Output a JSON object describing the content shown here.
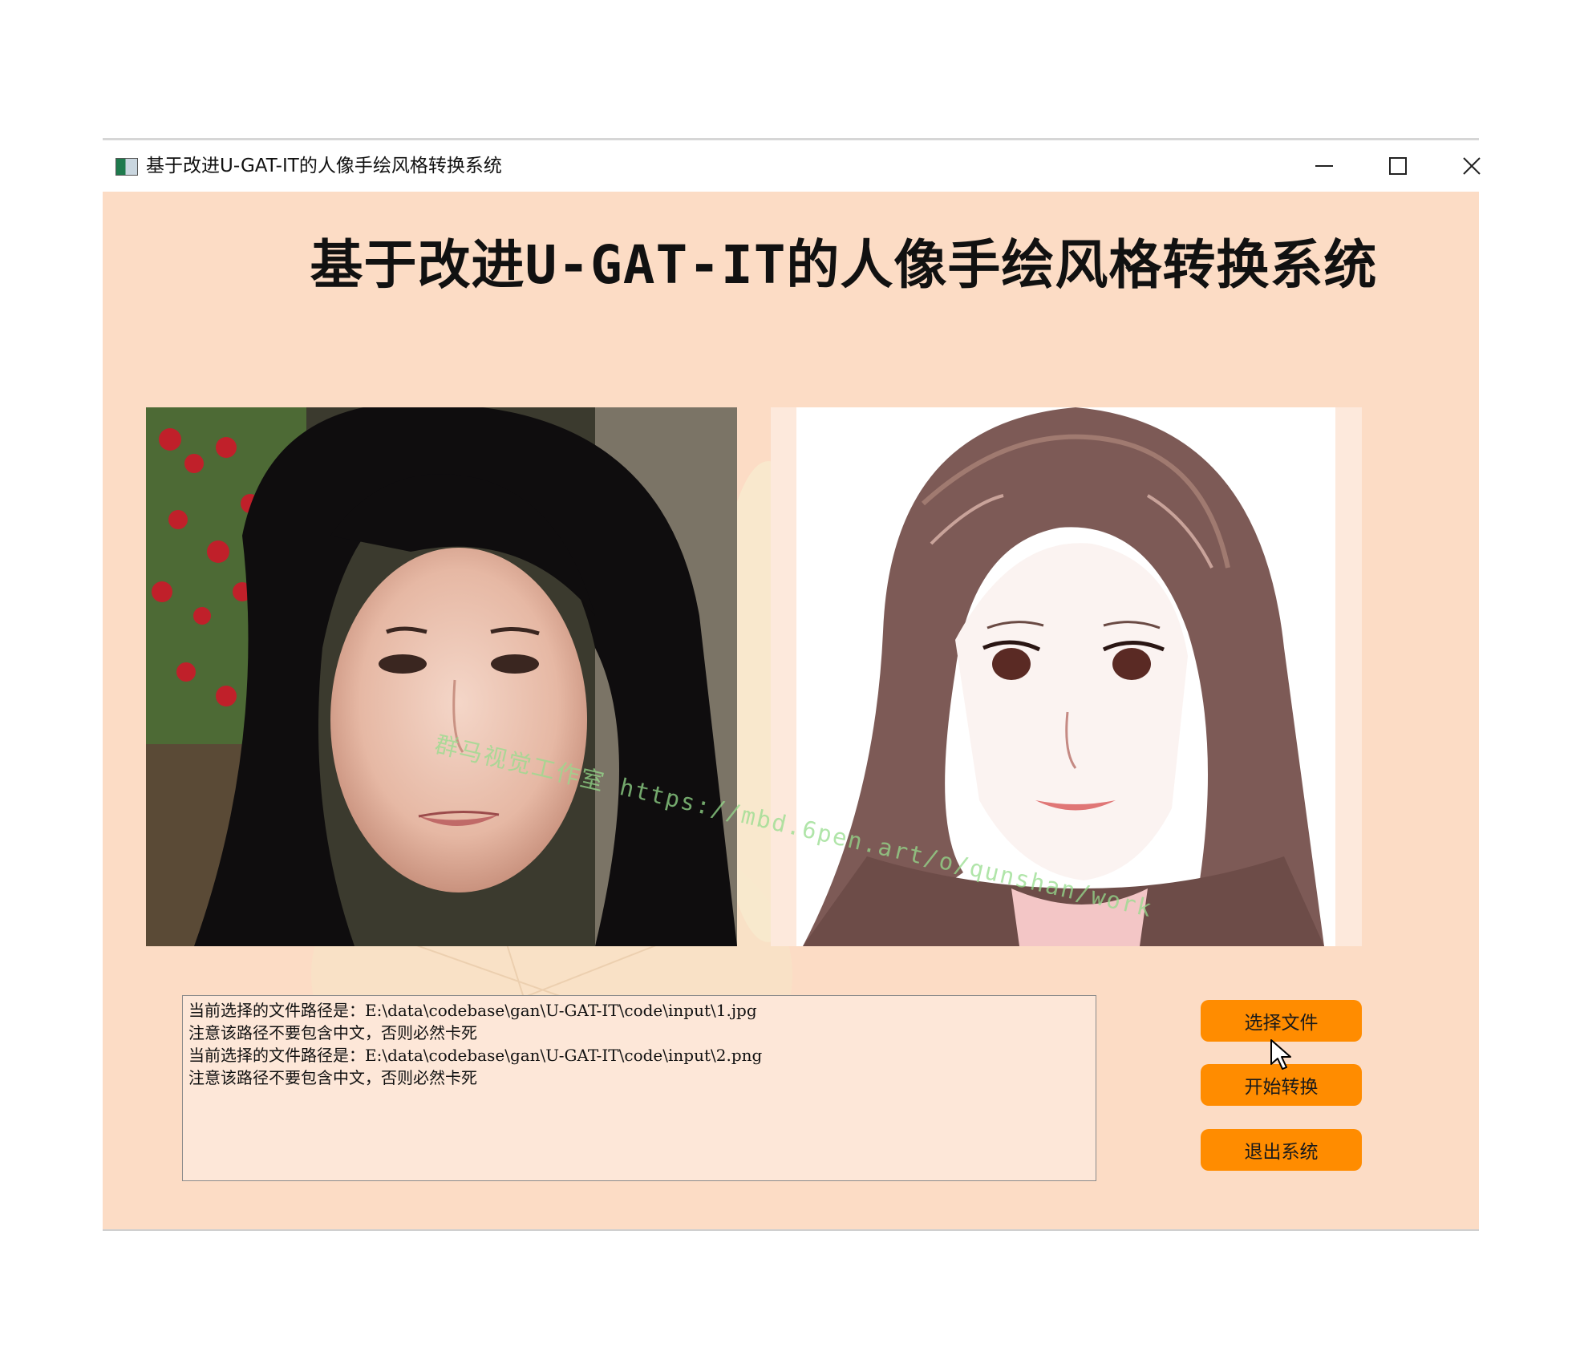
{
  "window": {
    "title": "基于改进U-GAT-IT的人像手绘风格转换系统"
  },
  "header": {
    "title": "基于改进U-GAT-IT的人像手绘风格转换系统"
  },
  "images": {
    "original": "portrait-photo",
    "converted": "hand-drawn-portrait"
  },
  "log": {
    "lines": [
      "当前选择的文件路径是：E:\\data\\codebase\\gan\\U-GAT-IT\\code\\input\\1.jpg",
      "注意该路径不要包含中文，否则必然卡死",
      "当前选择的文件路径是：E:\\data\\codebase\\gan\\U-GAT-IT\\code\\input\\2.png",
      "注意该路径不要包含中文，否则必然卡死"
    ]
  },
  "buttons": {
    "select_file": "选择文件",
    "start_convert": "开始转换",
    "exit_system": "退出系统"
  },
  "watermark": "群马视觉工作室 https://mbd.6pen.art/o/qunshan/work",
  "colors": {
    "window_bg": "#fcdcc5",
    "button_bg": "#ff8c00",
    "log_bg": "#fde7d8"
  }
}
